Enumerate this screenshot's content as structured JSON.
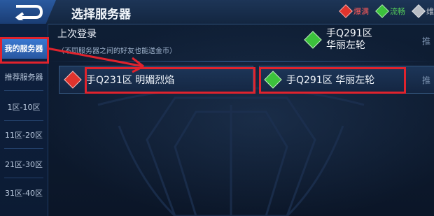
{
  "header": {
    "title": "选择服务器",
    "legend": [
      {
        "label": "爆满",
        "color": "#e0342d"
      },
      {
        "label": "流畅",
        "color": "#3cc23c"
      },
      {
        "label": "维",
        "color": "#b9bec6"
      }
    ]
  },
  "sidebar": {
    "items": [
      {
        "label": "我的服务器"
      },
      {
        "label": "推荐服务器"
      },
      {
        "label": "1区-10区"
      },
      {
        "label": "11区-20区"
      },
      {
        "label": "21区-30区"
      },
      {
        "label": "31区-40区"
      }
    ]
  },
  "last_login": {
    "title": "上次登录",
    "note": "（不同服务器之间的好友也能送金币）",
    "server_zone": "手Q291区",
    "server_name": "华丽左轮",
    "tag": "推"
  },
  "servers": [
    {
      "label": "手Q231区 明媚烈焰",
      "status": "full"
    },
    {
      "label": "手Q291区 华丽左轮",
      "status": "smooth"
    }
  ],
  "cards_tag": "推"
}
